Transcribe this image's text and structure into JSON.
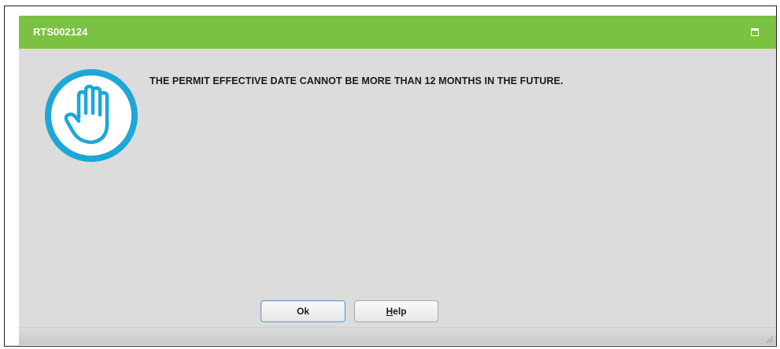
{
  "dialog": {
    "title": "RTS002124",
    "message": "THE PERMIT EFFECTIVE DATE CANNOT BE MORE THAN 12 MONTHS IN THE FUTURE.",
    "icon": "stop-hand-icon",
    "accent_color": "#7bc142",
    "icon_color": "#1ea7d6"
  },
  "buttons": {
    "ok_label": "Ok",
    "help_mnemonic": "H",
    "help_rest": "elp"
  }
}
